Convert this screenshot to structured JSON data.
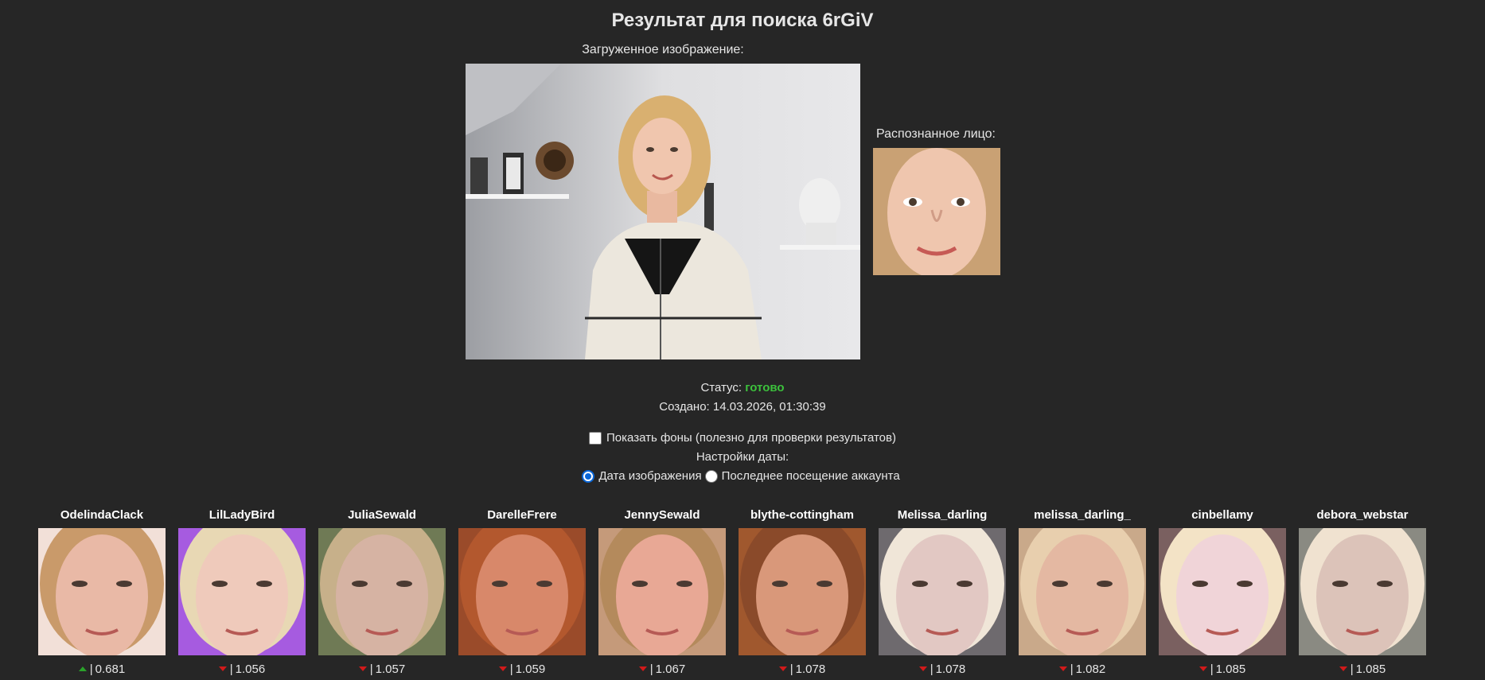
{
  "header": {
    "title": "Результат для поиска 6rGiV"
  },
  "uploaded": {
    "label": "Загруженное изображение:"
  },
  "detected_face": {
    "label": "Распознанное лицо:"
  },
  "status": {
    "label": "Статус:",
    "value": "готово",
    "value_color": "#3cc13c"
  },
  "created": {
    "text": "Создано: 14.03.2026, 01:30:39"
  },
  "options": {
    "show_backgrounds_label": "Показать фоны (полезно для проверки результатов)",
    "show_backgrounds_checked": false,
    "date_settings_label": "Настройки даты:",
    "date_options": [
      {
        "label": "Дата изображения",
        "checked": true
      },
      {
        "label": "Последнее посещение аккаунта",
        "checked": false
      }
    ]
  },
  "results": [
    {
      "name": "OdelindaClack",
      "score": "0.681",
      "trend": "up",
      "skin": "#e9b9a6",
      "hair": "#c99a6a",
      "bg": "#f2e0d8"
    },
    {
      "name": "LilLadyBird",
      "score": "1.056",
      "trend": "down",
      "skin": "#efcabb",
      "hair": "#e8d8b4",
      "bg": "#a65be0"
    },
    {
      "name": "JuliaSewald",
      "score": "1.057",
      "trend": "down",
      "skin": "#d6b3a3",
      "hair": "#c7b08a",
      "bg": "#6f7a55"
    },
    {
      "name": "DarelleFrere",
      "score": "1.059",
      "trend": "down",
      "skin": "#d8886a",
      "hair": "#b3582e",
      "bg": "#9a4b2a"
    },
    {
      "name": "JennySewald",
      "score": "1.067",
      "trend": "down",
      "skin": "#e8a895",
      "hair": "#b48a5c",
      "bg": "#c59a7a"
    },
    {
      "name": "blythe-cottingham",
      "score": "1.078",
      "trend": "down",
      "skin": "#d9987a",
      "hair": "#8a4a2a",
      "bg": "#a0582e"
    },
    {
      "name": "Melissa_darling",
      "score": "1.078",
      "trend": "down",
      "skin": "#e2c8c3",
      "hair": "#f0e6d8",
      "bg": "#6e6a6e"
    },
    {
      "name": "melissa_darling_",
      "score": "1.082",
      "trend": "down",
      "skin": "#e4b8a2",
      "hair": "#e8cfae",
      "bg": "#c9a98a"
    },
    {
      "name": "cinbellamy",
      "score": "1.085",
      "trend": "down",
      "skin": "#f0d4d8",
      "hair": "#f3e3c6",
      "bg": "#7a6060"
    },
    {
      "name": "debora_webstar",
      "score": "1.085",
      "trend": "down",
      "skin": "#dcc3b9",
      "hair": "#f0e2d0",
      "bg": "#8a8a82"
    }
  ]
}
